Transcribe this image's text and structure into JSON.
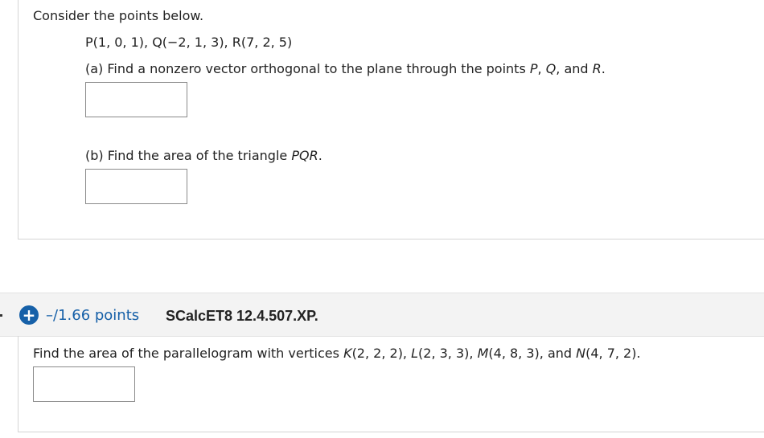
{
  "question1": {
    "intro": "Consider the points below.",
    "points_line": "P(1, 0, 1),  Q(−2, 1, 3),  R(7, 2, 5)",
    "part_a": {
      "prefix": "(a) Find a nonzero vector orthogonal to the plane through the points ",
      "p": "P",
      "q": "Q",
      "and": "and",
      "r": "R",
      "answer": ""
    },
    "part_b": {
      "prefix": "(b) Find the area of the triangle ",
      "tri": "PQR",
      "period": ".",
      "answer": ""
    }
  },
  "question2": {
    "points": "–/1.66 points",
    "source": "SCalcET8 12.4.507.XP.",
    "plus_icon": "plus-circle-icon",
    "prompt": {
      "prefix": "Find the area of the parallelogram with vertices ",
      "k": "K",
      "k_coords": "(2, 2, 2),",
      "l": "L",
      "l_coords": "(2, 3, 3),",
      "m": "M",
      "m_coords": "(4, 8, 3),",
      "and": "and",
      "n": "N",
      "n_coords": "(4, 7, 2)."
    },
    "answer": ""
  },
  "colors": {
    "accent": "#1660a8",
    "header_bg": "#f3f3f3",
    "text": "#222222"
  }
}
